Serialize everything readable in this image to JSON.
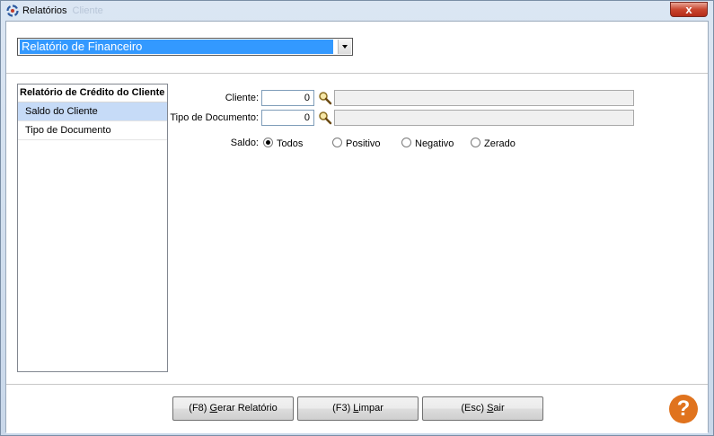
{
  "window": {
    "title": "Relatórios",
    "title_ghost": "Cliente",
    "close_glyph": "x"
  },
  "report_select": {
    "selected": "Relatório de Financeiro"
  },
  "sidebar": {
    "header": "Relatório de Crédito do Cliente",
    "items": [
      {
        "label": "Saldo do Cliente",
        "selected": true
      },
      {
        "label": "Tipo de Documento",
        "selected": false
      }
    ]
  },
  "form": {
    "cliente": {
      "label": "Cliente:",
      "value": "0",
      "description": ""
    },
    "tipo_documento": {
      "label": "Tipo de Documento:",
      "value": "0",
      "description": ""
    },
    "saldo": {
      "label": "Saldo:",
      "options": [
        {
          "label": "Todos",
          "checked": true
        },
        {
          "label": "Positivo",
          "checked": false
        },
        {
          "label": "Negativo",
          "checked": false
        },
        {
          "label": "Zerado",
          "checked": false
        }
      ]
    }
  },
  "buttons": {
    "gerar": {
      "prefix": "(F8) ",
      "accel": "G",
      "rest": "erar Relatório"
    },
    "limpar": {
      "prefix": "(F3) ",
      "accel": "L",
      "rest": "impar"
    },
    "sair": {
      "prefix": "(Esc) ",
      "accel": "S",
      "rest": "air"
    }
  },
  "help": {
    "glyph": "?"
  },
  "colors": {
    "selection": "#3399ff",
    "sidebar_selected": "#c6dbf7",
    "help": "#e0731e"
  }
}
